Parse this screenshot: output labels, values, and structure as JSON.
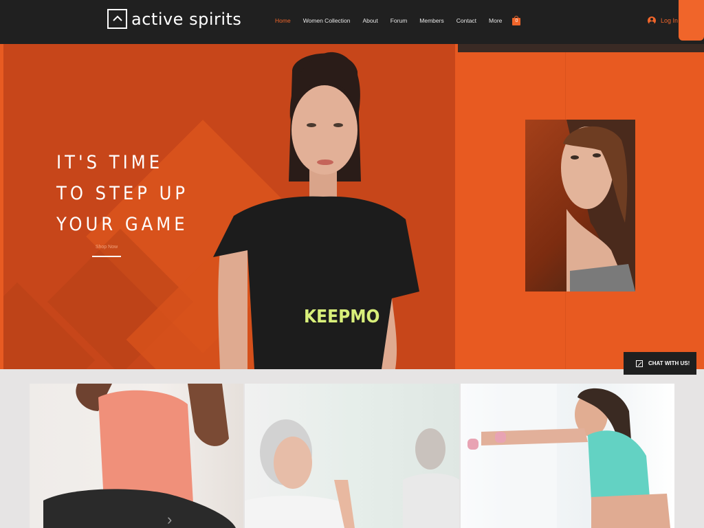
{
  "header": {
    "brand": "active spirits",
    "nav": [
      {
        "label": "Home",
        "active": true
      },
      {
        "label": "Women Collection",
        "active": false
      },
      {
        "label": "About",
        "active": false
      },
      {
        "label": "Forum",
        "active": false
      },
      {
        "label": "Members",
        "active": false
      },
      {
        "label": "Contact",
        "active": false
      },
      {
        "label": "More",
        "active": false
      }
    ],
    "cart_count": "0",
    "login_label": "Log In"
  },
  "hero": {
    "title": "IT'S TIME\nTO STEP UP\nYOUR GAME",
    "cta_label": "Shop Now",
    "shirt_text": "KEEPMO"
  },
  "chat": {
    "label": "CHAT WITH US!"
  },
  "colors": {
    "accent": "#f0652a",
    "header_bg": "#202020",
    "hero_left": "#c7461a",
    "hero_right": "#e85a21"
  }
}
